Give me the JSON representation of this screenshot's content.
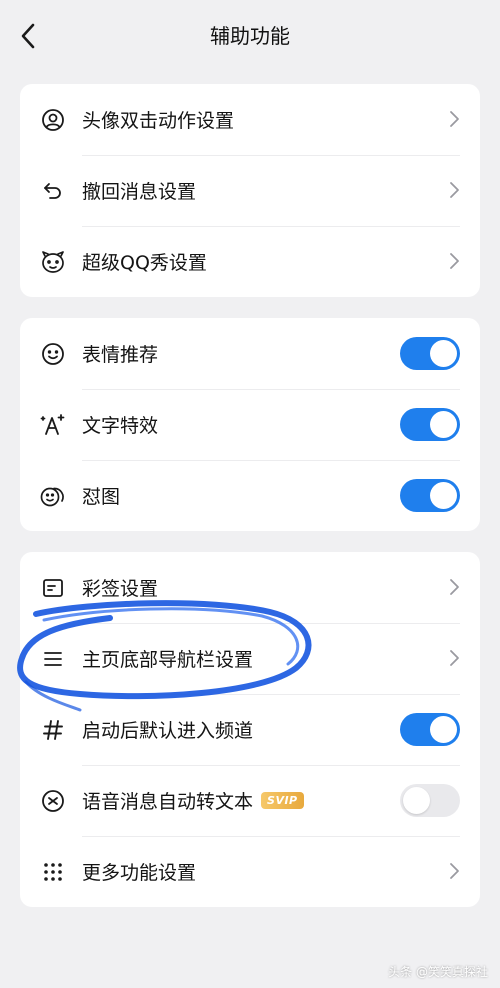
{
  "header": {
    "title": "辅助功能"
  },
  "group1": [
    {
      "label": "头像双击动作设置",
      "icon": "avatar-icon"
    },
    {
      "label": "撤回消息设置",
      "icon": "undo-icon"
    },
    {
      "label": "超级QQ秀设置",
      "icon": "qq-show-icon"
    }
  ],
  "group2": [
    {
      "label": "表情推荐",
      "icon": "smiley-icon",
      "toggle": true
    },
    {
      "label": "文字特效",
      "icon": "text-sparkle-icon",
      "toggle": true
    },
    {
      "label": "怼图",
      "icon": "sticker-icon",
      "toggle": true
    }
  ],
  "group3": [
    {
      "label": "彩签设置",
      "icon": "tag-icon"
    },
    {
      "label": "主页底部导航栏设置",
      "icon": "menu-lines-icon"
    },
    {
      "label": "启动后默认进入频道",
      "icon": "hash-icon",
      "toggle": true
    },
    {
      "label": "语音消息自动转文本",
      "icon": "voice-text-icon",
      "toggle": false,
      "badge": "SVIP"
    },
    {
      "label": "更多功能设置",
      "icon": "grid-dots-icon"
    }
  ],
  "watermark": "头条 @笑笑真探社",
  "colors": {
    "accent": "#1f7fed",
    "background": "#f0f0f2",
    "annotation": "#1656e0"
  }
}
